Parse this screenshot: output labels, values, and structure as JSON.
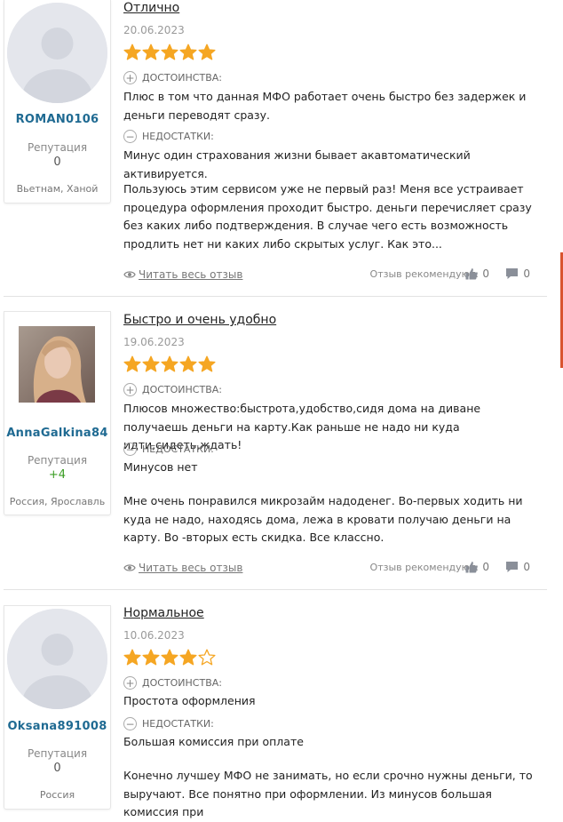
{
  "colors": {
    "star": "#f5a623",
    "username": "#1f6a92",
    "positive_rep": "#3a9d23"
  },
  "labels": {
    "pros": "ДОСТОИНСТВА:",
    "cons": "НЕДОСТАТКИ:",
    "reputation": "Репутация",
    "read_more": "Читать весь отзыв",
    "recommend": "Отзыв рекомендуют:"
  },
  "reviews": [
    {
      "title": "Отлично",
      "date": "20.06.2023",
      "rating": 5,
      "username": "ROMAN0106",
      "reputation": "0",
      "location": "Вьетнам, Ханой",
      "avatar": "default-avatar",
      "pros": "Плюс в том что данная МФО работает очень быстро без задержек и деньги переводят сразу.",
      "cons": "Минус один страхования жизни бывает акавтоматический активируется.",
      "body": "Пользуюсь этим сервисом уже не первый раз! Меня все устраивает процедура оформления проходит быстро. деньги перечисляет сразу без каких либо подтверждения. В случае чего есть возможность продлить нет ни каких либо скрытых услуг. Как это...",
      "likes": "0",
      "comments": "0"
    },
    {
      "title": "Быстро и очень удобно",
      "date": "19.06.2023",
      "rating": 5,
      "username": "AnnaGalkina84",
      "reputation": "+4",
      "location": "Россия, Ярославль",
      "avatar": "user-photo",
      "pros": "Плюсов множество:быстрота,удобство,сидя дома на диване получаешь деньги на карту.Как раньше не надо ни куда идти,сидеть,ждать!",
      "cons": "Минусов нет",
      "body": "Мне очень понравился микрозайм надоденег. Во-первых ходить ни куда не надо, находясь дома, лежа в кровати получаю деньги на карту. Во -вторых есть скидка. Все классно.",
      "likes": "0",
      "comments": "0"
    },
    {
      "title": "Нормальное",
      "date": "10.06.2023",
      "rating": 4,
      "username": "Oksana891008",
      "reputation": "0",
      "location": "Россия",
      "avatar": "default-avatar",
      "pros": "Простота оформления",
      "cons": "Большая комиссия при оплате",
      "body": "Конечно лучшеу МФО не занимать, но если срочно нужны деньги, то выручают. Все понятно при оформлении. Из минусов большая комиссия при"
    }
  ]
}
